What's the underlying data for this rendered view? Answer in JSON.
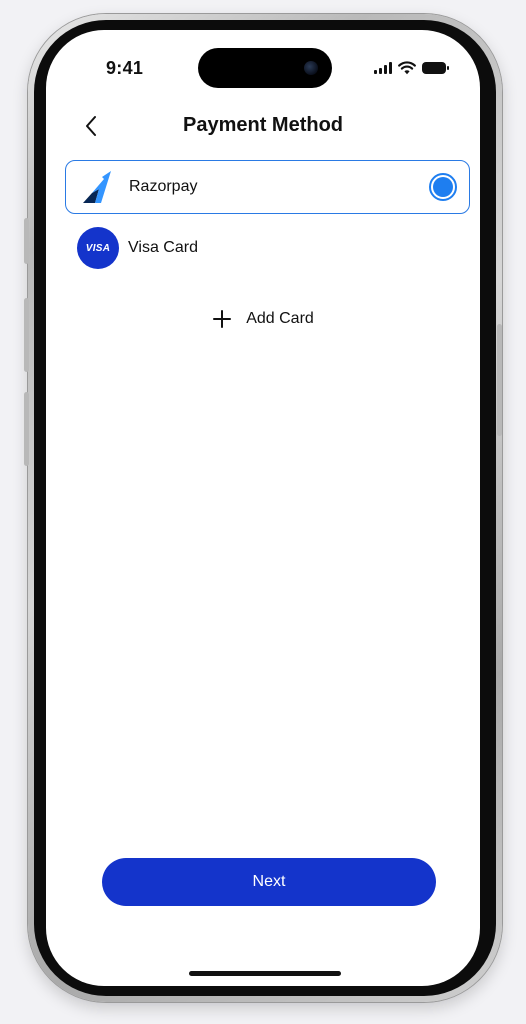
{
  "status_bar": {
    "time": "9:41"
  },
  "header": {
    "title": "Payment Method"
  },
  "payment_methods": [
    {
      "label": "Razorpay",
      "selected": true
    },
    {
      "label": "Visa Card",
      "logo_text": "VISA",
      "selected": false
    }
  ],
  "add_card": {
    "label": "Add Card"
  },
  "footer": {
    "next_label": "Next"
  },
  "colors": {
    "accent": "#1e7ef0",
    "primary_button": "#1434cb",
    "visa_blue": "#1434cb",
    "razorpay_dark": "#072654",
    "razorpay_light": "#3395ff"
  }
}
